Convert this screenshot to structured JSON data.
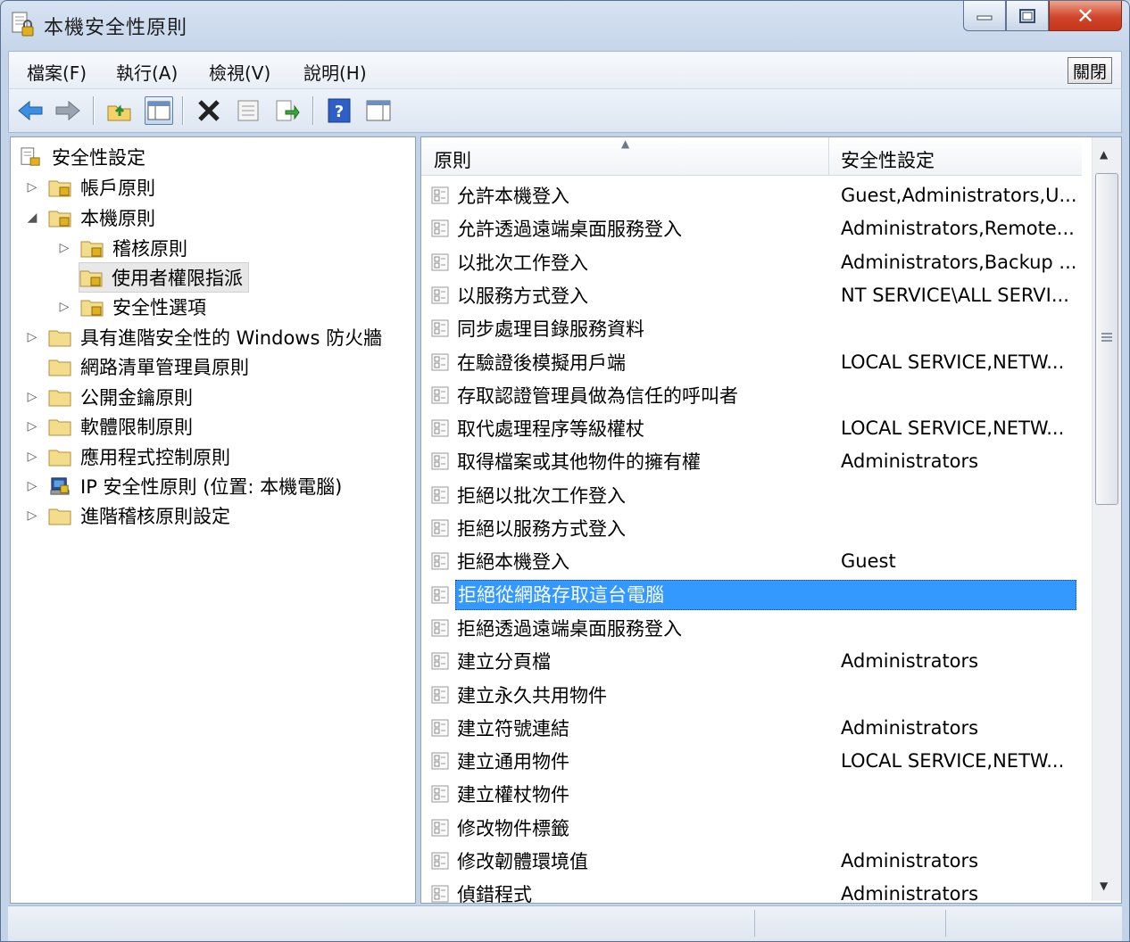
{
  "window": {
    "title": "本機安全性原則"
  },
  "menubar": {
    "items": [
      "檔案(F)",
      "執行(A)",
      "檢視(V)",
      "說明(H)"
    ],
    "close_button": "關閉"
  },
  "tree": {
    "root": "安全性設定",
    "nodes": [
      "帳戶原則",
      "本機原則",
      "稽核原則",
      "使用者權限指派",
      "安全性選項",
      "具有進階安全性的 Windows 防火牆",
      "網路清單管理員原則",
      "公開金鑰原則",
      "軟體限制原則",
      "應用程式控制原則",
      "IP 安全性原則 (位置: 本機電腦)",
      "進階稽核原則設定"
    ]
  },
  "list": {
    "col_policy": "原則",
    "col_setting": "安全性設定",
    "rows": [
      {
        "name": "允許本機登入",
        "value": "Guest,Administrators,U..."
      },
      {
        "name": "允許透過遠端桌面服務登入",
        "value": "Administrators,Remote..."
      },
      {
        "name": "以批次工作登入",
        "value": "Administrators,Backup ..."
      },
      {
        "name": "以服務方式登入",
        "value": "NT SERVICE\\ALL SERVI..."
      },
      {
        "name": "同步處理目錄服務資料",
        "value": ""
      },
      {
        "name": "在驗證後模擬用戶端",
        "value": "LOCAL SERVICE,NETW..."
      },
      {
        "name": "存取認證管理員做為信任的呼叫者",
        "value": ""
      },
      {
        "name": "取代處理程序等級權杖",
        "value": "LOCAL SERVICE,NETW..."
      },
      {
        "name": "取得檔案或其他物件的擁有權",
        "value": "Administrators"
      },
      {
        "name": "拒絕以批次工作登入",
        "value": ""
      },
      {
        "name": "拒絕以服務方式登入",
        "value": ""
      },
      {
        "name": "拒絕本機登入",
        "value": "Guest"
      },
      {
        "name": "拒絕從網路存取這台電腦",
        "value": ""
      },
      {
        "name": "拒絕透過遠端桌面服務登入",
        "value": ""
      },
      {
        "name": "建立分頁檔",
        "value": "Administrators"
      },
      {
        "name": "建立永久共用物件",
        "value": ""
      },
      {
        "name": "建立符號連結",
        "value": "Administrators"
      },
      {
        "name": "建立通用物件",
        "value": "LOCAL SERVICE,NETW..."
      },
      {
        "name": "建立權杖物件",
        "value": ""
      },
      {
        "name": "修改物件標籤",
        "value": ""
      },
      {
        "name": "修改韌體環境值",
        "value": "Administrators"
      },
      {
        "name": "偵錯程式",
        "value": "Administrators"
      }
    ]
  },
  "icons": [
    "back-arrow-icon",
    "forward-arrow-icon",
    "up-folder-icon",
    "show-hide-tree-icon",
    "delete-icon",
    "properties-icon",
    "export-list-icon",
    "help-icon",
    "show-pane-icon"
  ],
  "colors": {
    "selection": "#3399ff",
    "close": "#c9472b"
  }
}
